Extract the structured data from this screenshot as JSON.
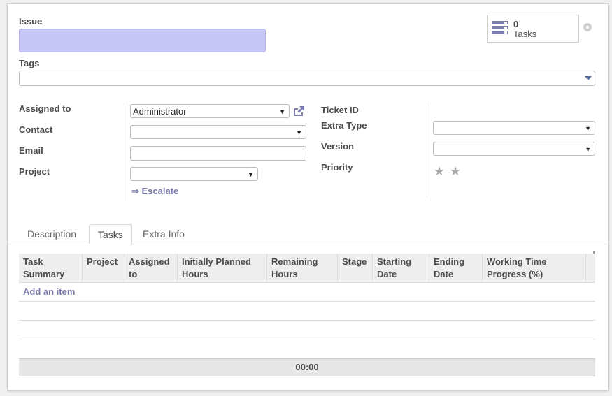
{
  "form": {
    "issue_label": "Issue",
    "issue_value": "",
    "tags_label": "Tags",
    "tags_value": ""
  },
  "smart_button": {
    "count": "0",
    "label": "Tasks",
    "icon": "tasks-icon",
    "icon_color": "#7c7bad"
  },
  "fields_left": {
    "assigned_to_label": "Assigned to",
    "assigned_to_value": "Administrator",
    "contact_label": "Contact",
    "contact_value": "",
    "email_label": "Email",
    "email_value": "",
    "project_label": "Project",
    "project_value": "",
    "escalate_label": "⇒ Escalate"
  },
  "fields_right": {
    "ticket_id_label": "Ticket ID",
    "ticket_id_value": "",
    "extra_type_label": "Extra Type",
    "extra_type_value": "",
    "version_label": "Version",
    "version_value": "",
    "priority_label": "Priority",
    "priority_stars_filled": 0,
    "priority_stars_total": 2
  },
  "tabs": [
    {
      "label": "Description",
      "active": false
    },
    {
      "label": "Tasks",
      "active": true
    },
    {
      "label": "Extra Info",
      "active": false
    }
  ],
  "tasks_table": {
    "columns": [
      "Task Summary",
      "Project",
      "Assigned to",
      "Initially Planned Hours",
      "Remaining Hours",
      "Stage",
      "Starting Date",
      "Ending Date",
      "Working Time Progress (%)"
    ],
    "add_item_label": "Add an item",
    "footer_total": "00:00"
  },
  "colors": {
    "accent": "#7c7bad",
    "issue_input_bg": "#c7c7f7"
  }
}
